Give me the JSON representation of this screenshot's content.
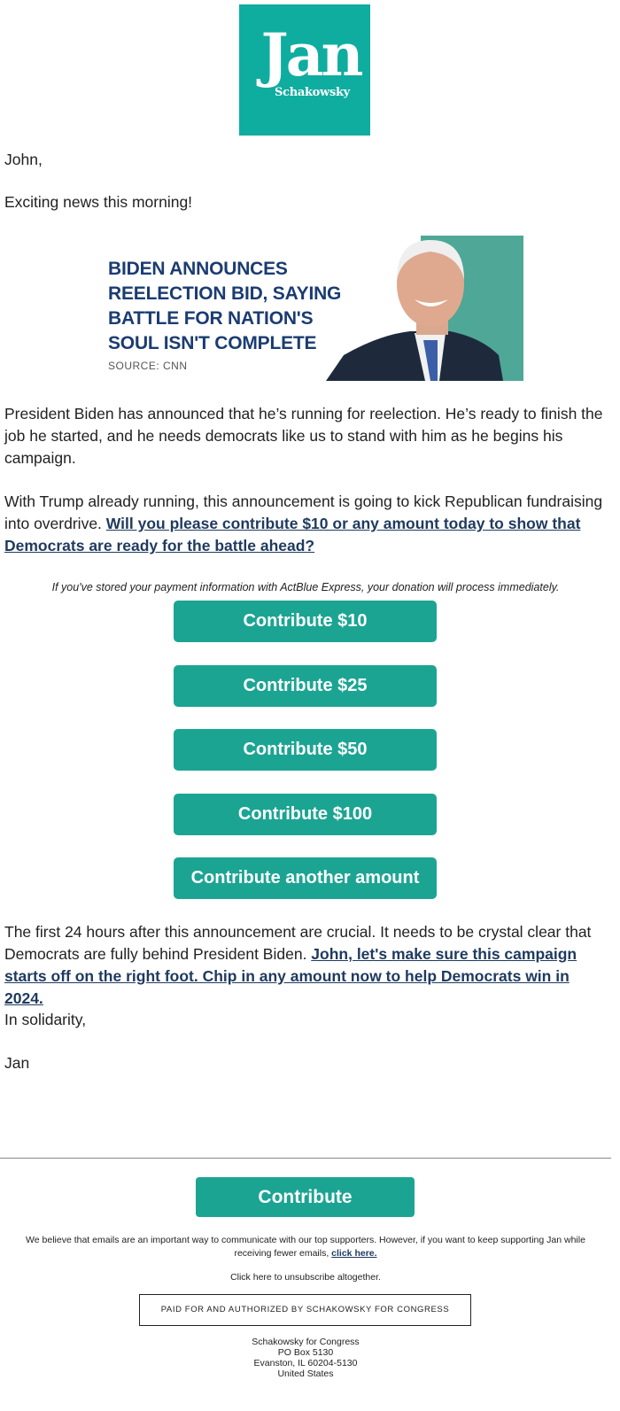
{
  "logo": {
    "first_name": "Jan",
    "last_name": "Schakowsky",
    "brand_color": "#0fada0"
  },
  "greeting": "John,",
  "intro": "Exciting news this morning!",
  "banner": {
    "headline": "BIDEN ANNOUNCES REELECTION BID, SAYING BATTLE FOR NATION'S SOUL ISN'T COMPLETE",
    "source": "SOURCE: CNN",
    "image": "portrait-of-president-biden"
  },
  "body": {
    "para1": "President Biden has announced that he’s running for reelection. He’s ready to finish the job he started, and he needs democrats like us to stand with him as he begins his campaign.",
    "para2_text": "With Trump already running, this announcement is going to kick Republican fundraising into overdrive. ",
    "para2_link": "Will you please contribute $10 or any amount today to show that Democrats are ready for the battle ahead?",
    "express_note": "If you've stored your payment information with ActBlue Express, your donation will process immediately.",
    "para3_text": "The first 24 hours after this announcement are crucial. It needs to be crystal clear that Democrats are fully behind President Biden. ",
    "para3_link": "John, let's make sure this campaign starts off on the right foot. Chip in any amount now to help Democrats win in 2024.",
    "signoff": "In solidarity,",
    "signature": "Jan"
  },
  "buttons": [
    {
      "label": "Contribute $10"
    },
    {
      "label": "Contribute $25"
    },
    {
      "label": "Contribute $50"
    },
    {
      "label": "Contribute $100"
    },
    {
      "label": "Contribute another amount"
    }
  ],
  "button_color": "#1ca493",
  "footer": {
    "contribute_label": "Contribute",
    "fewer_emails_text": "We believe that emails are an important way to communicate with our top supporters. However, if you want to keep supporting Jan while receiving fewer emails, ",
    "fewer_emails_link": "click here.",
    "unsubscribe": "Click here to unsubscribe altogether.",
    "paid_for": "PAID FOR AND AUTHORIZED BY SCHAKOWSKY FOR CONGRESS",
    "address": [
      "Schakowsky for Congress",
      "PO Box 5130",
      "Evanston, IL 60204-5130",
      "United States"
    ]
  }
}
